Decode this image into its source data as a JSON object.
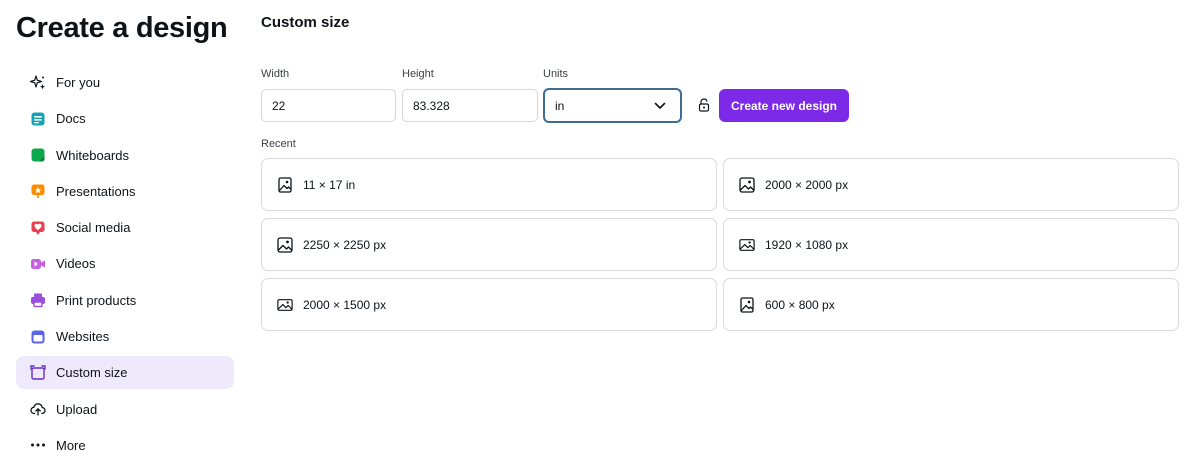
{
  "page_title": "Create a design",
  "sidebar": {
    "items": [
      {
        "label": "For you",
        "icon": "sparkle-icon",
        "active": false
      },
      {
        "label": "Docs",
        "icon": "docs-icon",
        "active": false
      },
      {
        "label": "Whiteboards",
        "icon": "whiteboard-icon",
        "active": false
      },
      {
        "label": "Presentations",
        "icon": "presentation-icon",
        "active": false
      },
      {
        "label": "Social media",
        "icon": "heart-icon",
        "active": false
      },
      {
        "label": "Videos",
        "icon": "video-icon",
        "active": false
      },
      {
        "label": "Print products",
        "icon": "printer-icon",
        "active": false
      },
      {
        "label": "Websites",
        "icon": "browser-icon",
        "active": false
      },
      {
        "label": "Custom size",
        "icon": "resize-icon",
        "active": true
      },
      {
        "label": "Upload",
        "icon": "upload-cloud-icon",
        "active": false
      },
      {
        "label": "More",
        "icon": "more-dots-icon",
        "active": false
      }
    ]
  },
  "custom_size": {
    "title": "Custom size",
    "width_label": "Width",
    "width_value": "22",
    "height_label": "Height",
    "height_value": "83.328",
    "units_label": "Units",
    "units_value": "in",
    "lock_icon": "unlock-icon",
    "create_button": "Create new design"
  },
  "recent": {
    "label": "Recent",
    "items": [
      {
        "label": "11 × 17 in",
        "icon": "portrait-image-icon"
      },
      {
        "label": "2000 × 2000 px",
        "icon": "square-image-icon"
      },
      {
        "label": "2250 × 2250 px",
        "icon": "square-image-icon"
      },
      {
        "label": "1920 × 1080 px",
        "icon": "landscape-image-icon"
      },
      {
        "label": "2000 × 1500 px",
        "icon": "landscape-image-icon"
      },
      {
        "label": "600 × 800 px",
        "icon": "portrait-image-icon"
      }
    ]
  },
  "colors": {
    "accent": "#7d2ae8",
    "active_bg": "#efe9fc",
    "select_border": "#3e6c93",
    "docs": "#13a3b5",
    "whiteboards": "#0ba84a",
    "presentations": "#ff8b00",
    "social_media": "#e8414f",
    "videos": "#c85fe0",
    "print_products": "#9b4ddb",
    "websites": "#5b63e6"
  }
}
